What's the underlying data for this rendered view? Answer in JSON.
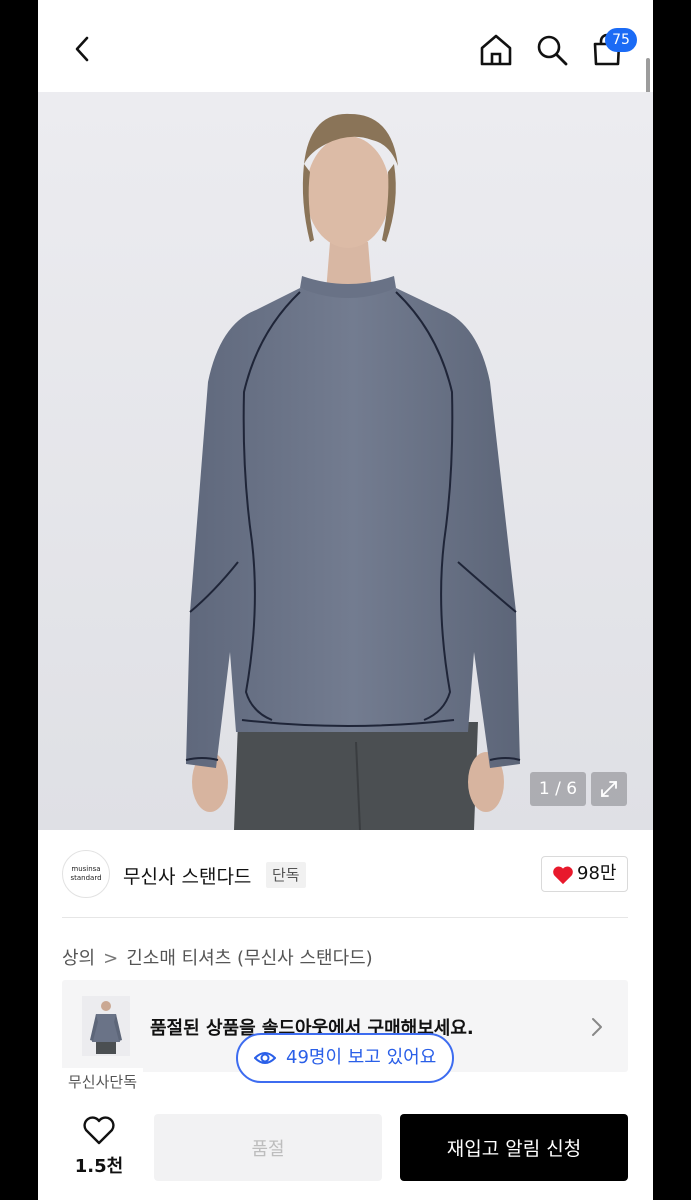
{
  "header": {
    "cart_count": "75"
  },
  "gallery": {
    "pager": "1 / 6"
  },
  "brand": {
    "logo_text_line1": "musinsa",
    "logo_text_line2": "standard",
    "name": "무신사 스탠다드",
    "tag": "단독",
    "like_count": "98만"
  },
  "breadcrumb": {
    "items": [
      "상의",
      "긴소매 티셔츠 (무신사 스탠다드)"
    ],
    "separator": ">"
  },
  "soldout_banner": {
    "text": "품절된 상품을 솔드아웃에서 구매해보세요.",
    "tag": "무신사단독"
  },
  "viewers": {
    "text": "49명이 보고 있어요"
  },
  "bottom": {
    "wish_count": "1.5천",
    "soldout_label": "품절",
    "restock_label": "재입고 알림 신청"
  },
  "colors": {
    "accent_blue": "#1b6bf5",
    "heart_red": "#e8192c",
    "shirt": "#6a7387"
  }
}
